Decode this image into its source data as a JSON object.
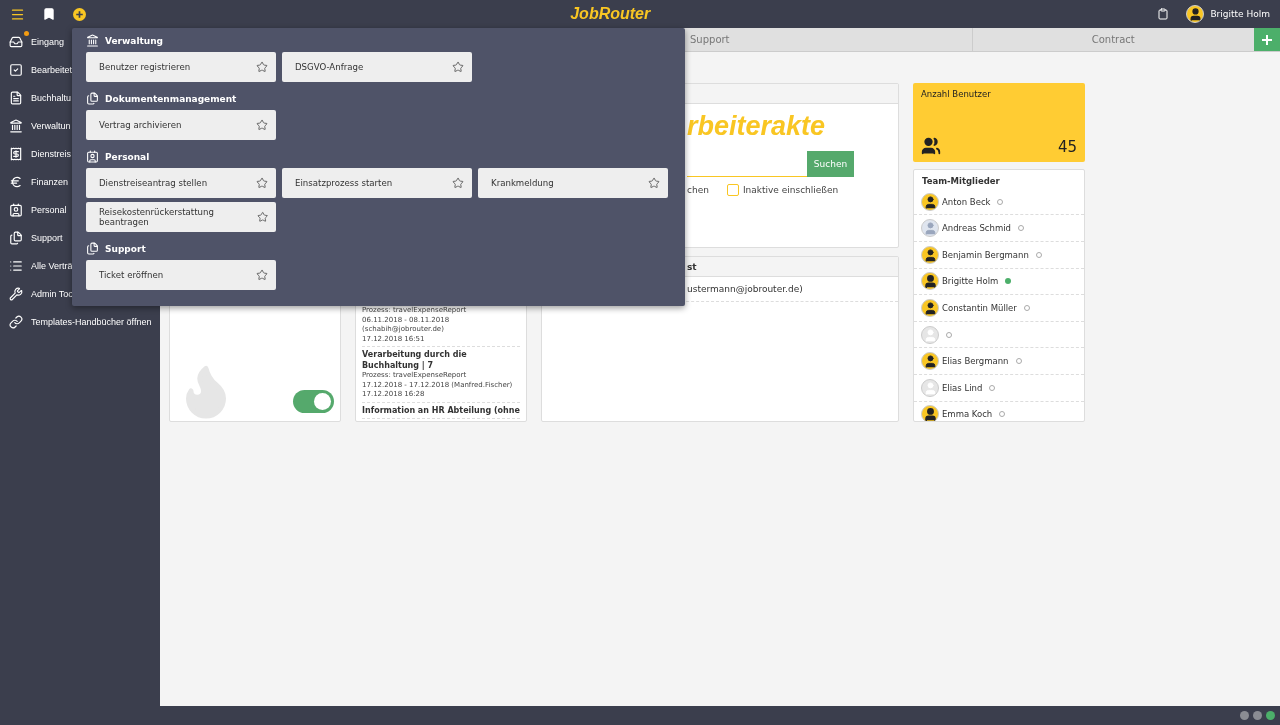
{
  "header": {
    "logo": "JobRouter",
    "user": "Brigitte Holm",
    "inbox_unread": true
  },
  "sidebar": {
    "items": [
      {
        "label": "Eingang",
        "kind": "inbox"
      },
      {
        "label": "Bearbeitet",
        "kind": "check"
      },
      {
        "label": "Buchhaltu",
        "kind": "file"
      },
      {
        "label": "Verwaltun",
        "kind": "bank"
      },
      {
        "label": "Dienstreis",
        "kind": "travel"
      },
      {
        "label": "Finanzen",
        "kind": "euro"
      },
      {
        "label": "Personal",
        "kind": "badge"
      },
      {
        "label": "Support",
        "kind": "docs"
      },
      {
        "label": "Alle Verträ",
        "kind": "list"
      },
      {
        "label": "Admin Too",
        "kind": "wrench"
      },
      {
        "label": "Templates-Handbücher öffnen",
        "kind": "link"
      }
    ]
  },
  "tabs": [
    {
      "label": "Support",
      "selected": false
    },
    {
      "label": "Contract",
      "selected": false
    }
  ],
  "menu": {
    "sections": [
      {
        "title": "Verwaltung",
        "kind": "bank",
        "items": [
          {
            "label": "Benutzer registrieren",
            "favorite": false
          },
          {
            "label": "DSGVO-Anfrage",
            "favorite": false
          }
        ]
      },
      {
        "title": "Dokumentenmanagement",
        "kind": "docs",
        "items": [
          {
            "label": "Vertrag archivieren",
            "favorite": false
          }
        ]
      },
      {
        "title": "Personal",
        "kind": "badge",
        "items": [
          {
            "label": "Dienstreiseantrag stellen",
            "favorite": false
          },
          {
            "label": "Einsatzprozess starten",
            "favorite": false
          },
          {
            "label": "Krankmeldung",
            "favorite": false
          },
          {
            "label": "Reisekostenrückerstattung beantragen",
            "favorite": false
          }
        ]
      },
      {
        "title": "Support",
        "kind": "docs",
        "items": [
          {
            "label": "Ticket eröffnen",
            "favorite": false
          }
        ]
      }
    ]
  },
  "toggle": {
    "on": true
  },
  "tasks": [
    {
      "lines": [
        "Prozess: travelExpenseReport",
        "06.11.2018 - 08.11.2018",
        "(schabih@jobrouter.de)"
      ],
      "date": "17.12.2018 16:51"
    },
    {
      "title": "Verarbeitung durch die Buchhaltung | 7",
      "lines": [
        "Prozess: travelExpenseReport",
        "17.12.2018 - 17.12.2018 (Manfred.Fischer)"
      ],
      "date": "17.12.2018 16:28"
    },
    {
      "title": "Information an HR Abteilung (ohne"
    }
  ],
  "search": {
    "logo": "rbeiterakte",
    "button": "Suchen",
    "option": "chen",
    "checkbox": {
      "label": "Inaktive einschließen",
      "checked": false
    }
  },
  "list": {
    "header": "st",
    "rows": [
      "ustermann@jobrouter.de)"
    ]
  },
  "user_count": {
    "title": "Anzahl Benutzer",
    "value": "45"
  },
  "team": {
    "title": "Team-Mitglieder",
    "members": [
      {
        "name": "Anton Beck",
        "kind": "male",
        "online": false
      },
      {
        "name": "Andreas Schmid",
        "kind": "photo",
        "online": false
      },
      {
        "name": "Benjamin Bergmann",
        "kind": "male",
        "online": false
      },
      {
        "name": "Brigitte Holm",
        "kind": "female",
        "online": true
      },
      {
        "name": "Constantin Müller",
        "kind": "male",
        "online": false
      },
      {
        "kind": "blank",
        "online": false
      },
      {
        "name": "Elias Bergmann",
        "kind": "male",
        "online": false
      },
      {
        "name": "Elias Lind",
        "kind": "blank",
        "online": false
      },
      {
        "name": "Emma Koch",
        "kind": "female",
        "online": false
      }
    ]
  },
  "status_dots": [
    {
      "color": "#8a8c93"
    },
    {
      "color": "#8a8c93"
    },
    {
      "color": "#4caf6a"
    }
  ]
}
